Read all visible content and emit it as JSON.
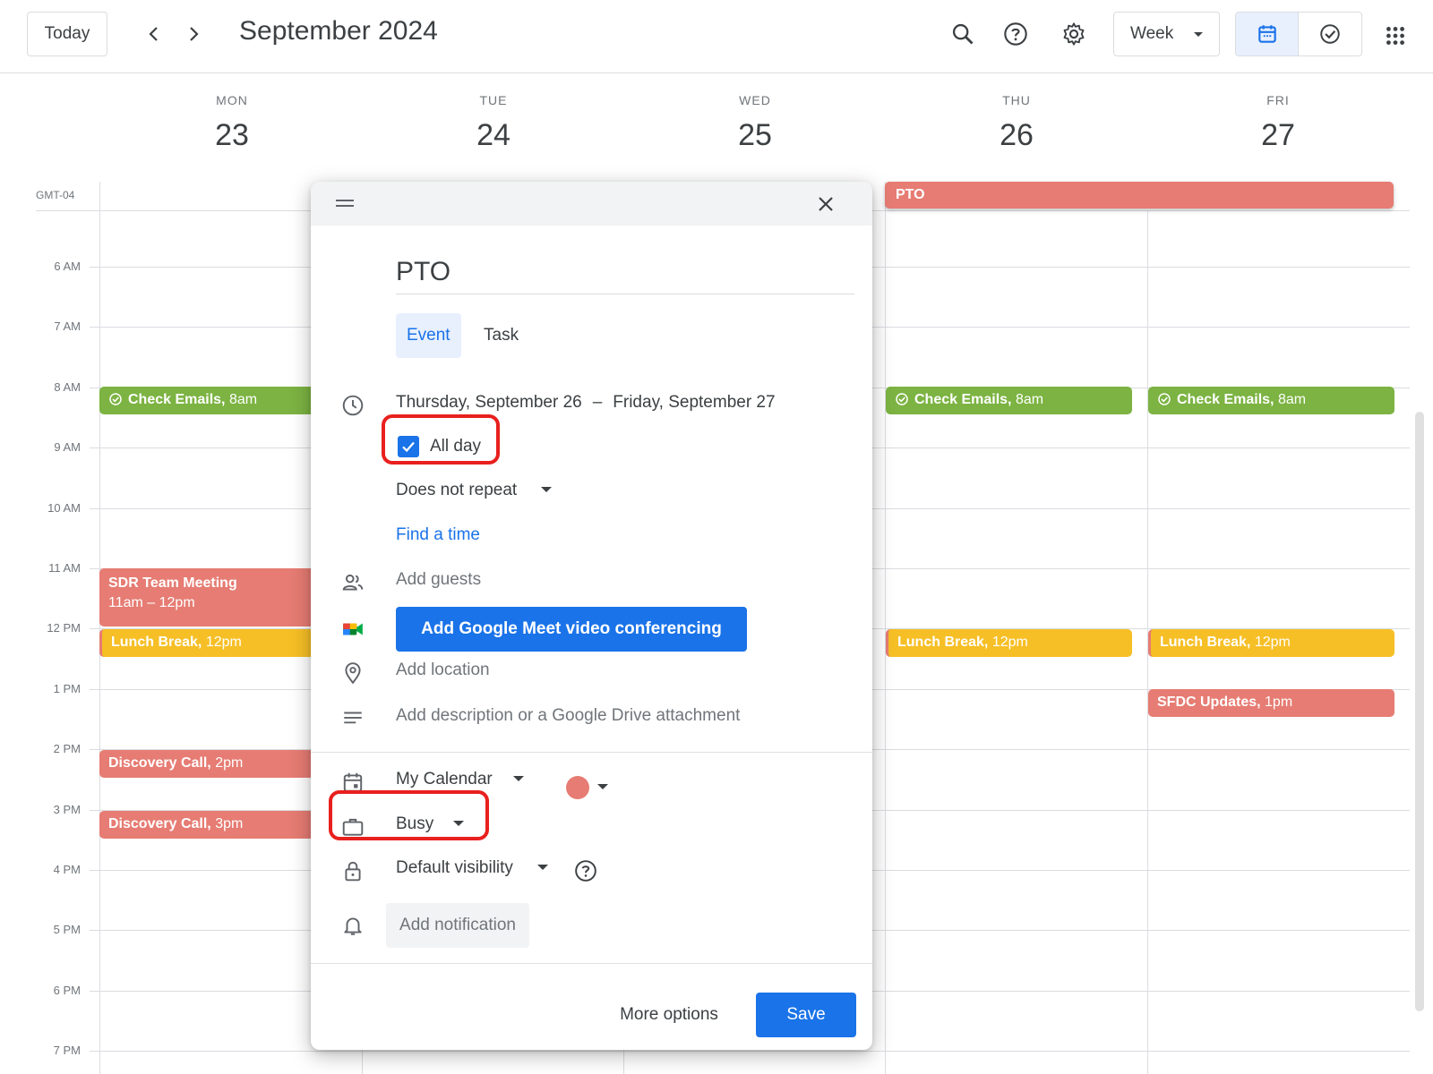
{
  "toolbar": {
    "today_label": "Today",
    "month_title": "September 2024",
    "view_label": "Week"
  },
  "icons": {
    "prev": "chevron-left-icon",
    "next": "chevron-right-icon",
    "search": "search-icon",
    "help": "help-icon",
    "settings": "gear-icon",
    "calendar_mode": "calendar-icon",
    "tasks_mode": "check-circle-icon",
    "apps": "apps-grid-icon"
  },
  "timezone": "GMT-04",
  "days": [
    {
      "dow": "MON",
      "num": "23"
    },
    {
      "dow": "TUE",
      "num": "24"
    },
    {
      "dow": "WED",
      "num": "25"
    },
    {
      "dow": "THU",
      "num": "26"
    },
    {
      "dow": "FRI",
      "num": "27"
    }
  ],
  "hours": [
    "6 AM",
    "7 AM",
    "8 AM",
    "9 AM",
    "10 AM",
    "11 AM",
    "12 PM",
    "1 PM",
    "2 PM",
    "3 PM",
    "4 PM",
    "5 PM",
    "6 PM",
    "7 PM"
  ],
  "events": {
    "pto_allday": "PTO",
    "check_emails_title": "Check Emails,",
    "check_emails_time": "8am",
    "sdr_title": "SDR Team Meeting",
    "sdr_time": "11am – 12pm",
    "lunch_title": "Lunch Break,",
    "lunch_time": "12pm",
    "discovery_title": "Discovery Call,",
    "discovery_time_1": "2pm",
    "discovery_time_2": "3pm",
    "sfdc_title": "SFDC Updates,",
    "sfdc_time": "1pm"
  },
  "dialog": {
    "title_value": "PTO",
    "tab_event": "Event",
    "tab_task": "Task",
    "start_date": "Thursday, September 26",
    "date_separator": "–",
    "end_date": "Friday, September 27",
    "all_day_label": "All day",
    "all_day_checked": true,
    "repeat_label": "Does not repeat",
    "find_time": "Find a time",
    "add_guests": "Add guests",
    "meet_button": "Add Google Meet video conferencing",
    "add_location": "Add location",
    "add_description": "Add description or a Google Drive attachment",
    "calendar_name": "My Calendar",
    "calendar_color": "#e67c73",
    "availability": "Busy",
    "visibility": "Default visibility",
    "add_notification": "Add notification",
    "more_options": "More options",
    "save": "Save"
  },
  "colors": {
    "accent": "#1a73e8",
    "event_red": "#e67c73",
    "event_green": "#7cb342",
    "event_yellow": "#f6bf26",
    "highlight": "#e8201e"
  }
}
